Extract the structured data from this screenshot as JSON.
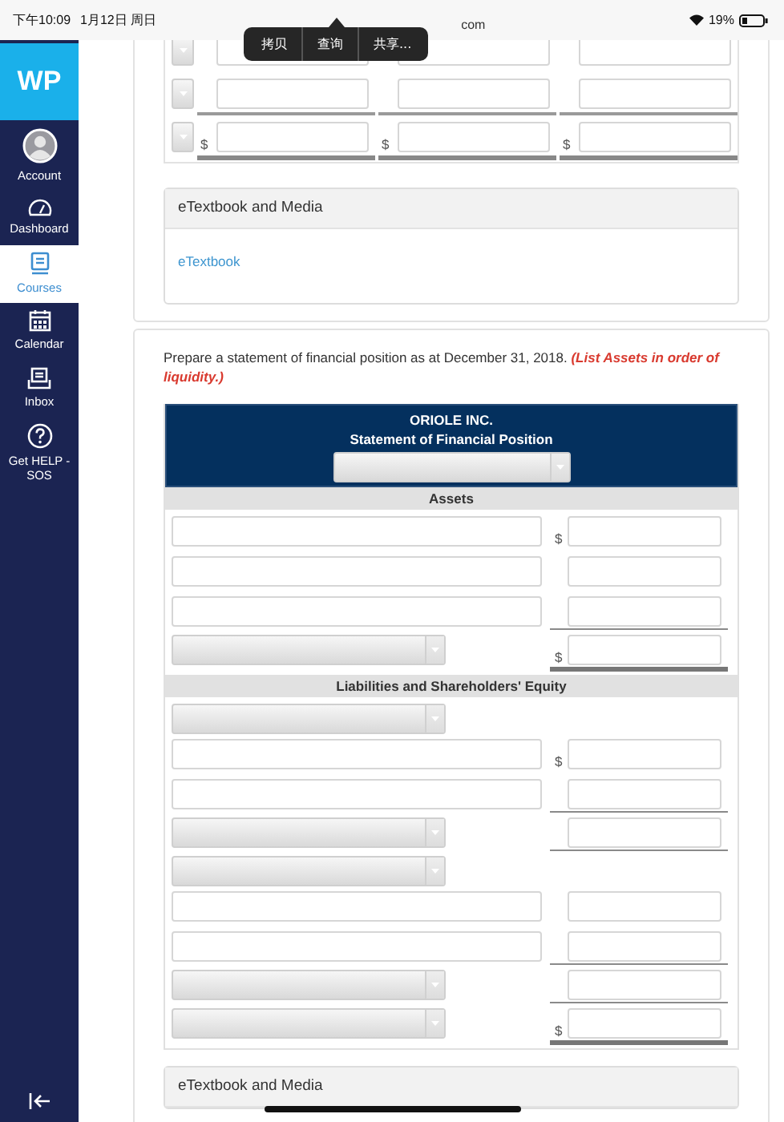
{
  "status_bar": {
    "time": "下午10:09",
    "date": "1月12日 周日",
    "url": "com",
    "battery": "19%"
  },
  "edit_menu": [
    "拷贝",
    "查询",
    "共享..."
  ],
  "sidebar": {
    "logo": "WP",
    "items": [
      {
        "label": "Account",
        "selected": false
      },
      {
        "label": "Dashboard",
        "selected": false
      },
      {
        "label": "Courses",
        "selected": true
      },
      {
        "label": "Calendar",
        "selected": false
      },
      {
        "label": "Inbox",
        "selected": false
      },
      {
        "label": "Get HELP - SOS",
        "selected": false
      }
    ]
  },
  "previous_part": {
    "rows": [
      {
        "underlined": false,
        "total": false
      },
      {
        "underlined": true,
        "total": false
      },
      {
        "underlined": false,
        "total": true,
        "currency": [
          "$",
          "$",
          "$"
        ]
      }
    ],
    "media_panel": {
      "title": "eTextbook and Media",
      "link": "eTextbook"
    }
  },
  "question": {
    "text": "Prepare a statement of financial position as at December 31, 2018. **(List Assets in order of liquidity.)**",
    "statement": {
      "company": "ORIOLE INC.",
      "title": "Statement of Financial Position",
      "sections": [
        {
          "heading": "Assets",
          "rows": [
            {
              "kind": "input",
              "amount": true,
              "currency": "$",
              "underlined": false,
              "total": false
            },
            {
              "kind": "input",
              "amount": true,
              "underlined": false,
              "total": false
            },
            {
              "kind": "input",
              "amount": true,
              "underlined": true,
              "total": false
            },
            {
              "kind": "select",
              "amount": true,
              "currency": "$",
              "underlined": false,
              "total": true
            }
          ]
        },
        {
          "heading": "Liabilities and Shareholders' Equity",
          "rows": [
            {
              "kind": "select",
              "amount": false
            },
            {
              "kind": "input",
              "amount": true,
              "currency": "$",
              "underlined": false,
              "total": false
            },
            {
              "kind": "input",
              "amount": true,
              "underlined": true,
              "total": false
            },
            {
              "kind": "select",
              "amount": true,
              "underlined": true,
              "total": false
            },
            {
              "kind": "select",
              "amount": false
            },
            {
              "kind": "input",
              "amount": true,
              "underlined": false,
              "total": false
            },
            {
              "kind": "input",
              "amount": true,
              "underlined": true,
              "total": false
            },
            {
              "kind": "select",
              "amount": true,
              "underlined": true,
              "total": false
            },
            {
              "kind": "select",
              "amount": true,
              "currency": "$",
              "underlined": false,
              "total": true
            }
          ]
        }
      ]
    },
    "media_panel": {
      "title": "eTextbook and Media"
    }
  }
}
